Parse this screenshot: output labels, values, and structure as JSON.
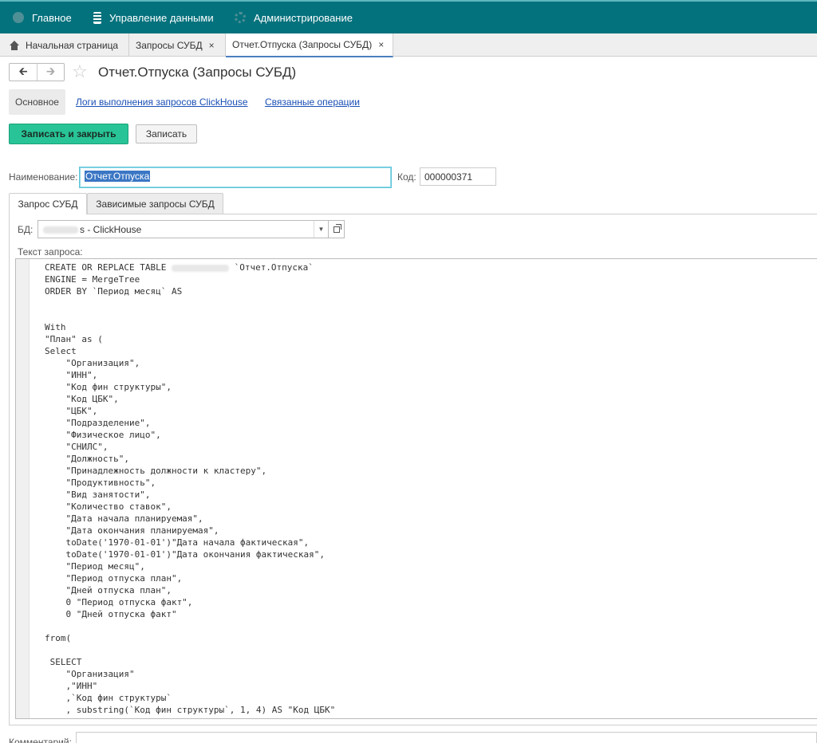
{
  "menu": {
    "items": [
      {
        "label": "Главное",
        "icon": "home-circle-icon"
      },
      {
        "label": "Управление данными",
        "icon": "database-icon"
      },
      {
        "label": "Администрирование",
        "icon": "gear-icon"
      }
    ]
  },
  "open_tabs": [
    {
      "label": "Начальная страница",
      "icon": "home-icon"
    },
    {
      "label": "Запросы СУБД",
      "close": "×"
    },
    {
      "label": "Отчет.Отпуска (Запросы СУБД)",
      "close": "×",
      "active": true
    }
  ],
  "form": {
    "title": "Отчет.Отпуска (Запросы СУБД)",
    "sections": {
      "main": "Основное",
      "links": [
        "Логи выполнения запросов ClickHouse",
        "Связанные операции"
      ]
    },
    "buttons": {
      "save_close": "Записать и закрыть",
      "save": "Записать"
    },
    "name_label": "Наименование:",
    "name_value": "Отчет.Отпуска",
    "code_label": "Код:",
    "code_value": "000000371",
    "inner_tabs": [
      "Запрос СУБД",
      "Зависимые запросы СУБД"
    ],
    "db_label": "БД:",
    "db_value": "s - ClickHouse",
    "query_label": "Текст запроса:",
    "comment_label": "Комментарий:"
  },
  "query_lines": [
    "CREATE OR REPLACE TABLE ",
    "ENGINE = MergeTree",
    "ORDER BY `Период месяц` AS",
    "",
    "",
    "With",
    "\"План\" as (",
    "Select",
    "    \"Организация\",",
    "    \"ИНН\",",
    "    \"Код фин структуры\",",
    "    \"Код ЦБК\",",
    "    \"ЦБК\",",
    "    \"Подразделение\",",
    "    \"Физическое лицо\",",
    "    \"СНИЛС\",",
    "    \"Должность\",",
    "    \"Принадлежность должности к кластеру\",",
    "    \"Продуктивность\",",
    "    \"Вид занятости\",",
    "    \"Количество ставок\",",
    "    \"Дата начала планируемая\",",
    "    \"Дата окончания планируемая\",",
    "    toDate('1970-01-01')\"Дата начала фактическая\",",
    "    toDate('1970-01-01')\"Дата окончания фактическая\",",
    "    \"Период месяц\",",
    "    \"Период отпуска план\",",
    "    \"Дней отпуска план\",",
    "    0 \"Период отпуска факт\",",
    "    0 \"Дней отпуска факт\"",
    "",
    "from(",
    "",
    " SELECT",
    "    \"Организация\"",
    "    ,\"ИНН\"",
    "    ,`Код фин структуры`",
    "    , substring(`Код фин структуры`, 1, 4) AS \"Код ЦБК\""
  ],
  "query_first_line_suffix": "`Отчет.Отпуска`"
}
